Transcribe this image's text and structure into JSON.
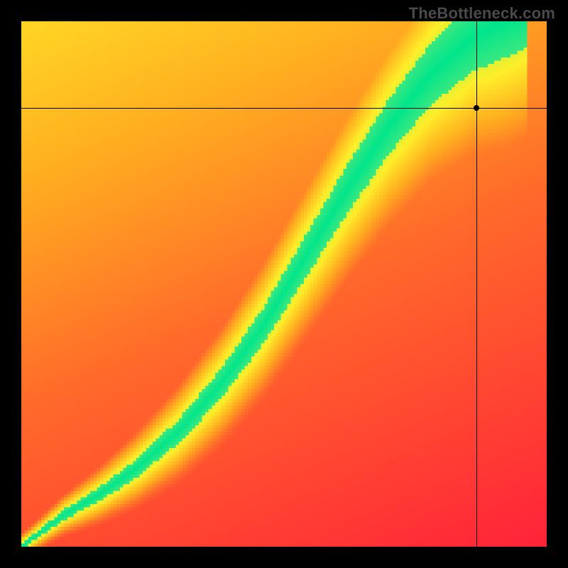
{
  "watermark": "TheBottleneck.com",
  "chart_data": {
    "type": "heatmap",
    "title": "",
    "xlabel": "",
    "ylabel": "",
    "xlim": [
      0,
      1
    ],
    "ylim": [
      0,
      1
    ],
    "grid": false,
    "legend": false,
    "crosshair": {
      "x": 0.866,
      "y": 0.835
    },
    "color_stops": [
      {
        "t": 0.0,
        "color": "#ff173b"
      },
      {
        "t": 0.35,
        "color": "#ff6a2a"
      },
      {
        "t": 0.55,
        "color": "#ffb21f"
      },
      {
        "t": 0.75,
        "color": "#ffee2a"
      },
      {
        "t": 0.88,
        "color": "#c8f23a"
      },
      {
        "t": 0.95,
        "color": "#60e97a"
      },
      {
        "t": 1.0,
        "color": "#00e58b"
      }
    ],
    "ridge": {
      "comment": "Approximate center-line of the green band as (x, y) pairs in [0,1] coords, y measured from bottom.",
      "points": [
        [
          0.0,
          0.0
        ],
        [
          0.08,
          0.06
        ],
        [
          0.15,
          0.1
        ],
        [
          0.22,
          0.15
        ],
        [
          0.3,
          0.22
        ],
        [
          0.38,
          0.31
        ],
        [
          0.46,
          0.42
        ],
        [
          0.54,
          0.55
        ],
        [
          0.62,
          0.68
        ],
        [
          0.7,
          0.8
        ],
        [
          0.78,
          0.9
        ],
        [
          0.86,
          0.97
        ],
        [
          0.92,
          1.0
        ]
      ],
      "width_min": 0.012,
      "width_max": 0.14
    },
    "resolution": 160
  }
}
